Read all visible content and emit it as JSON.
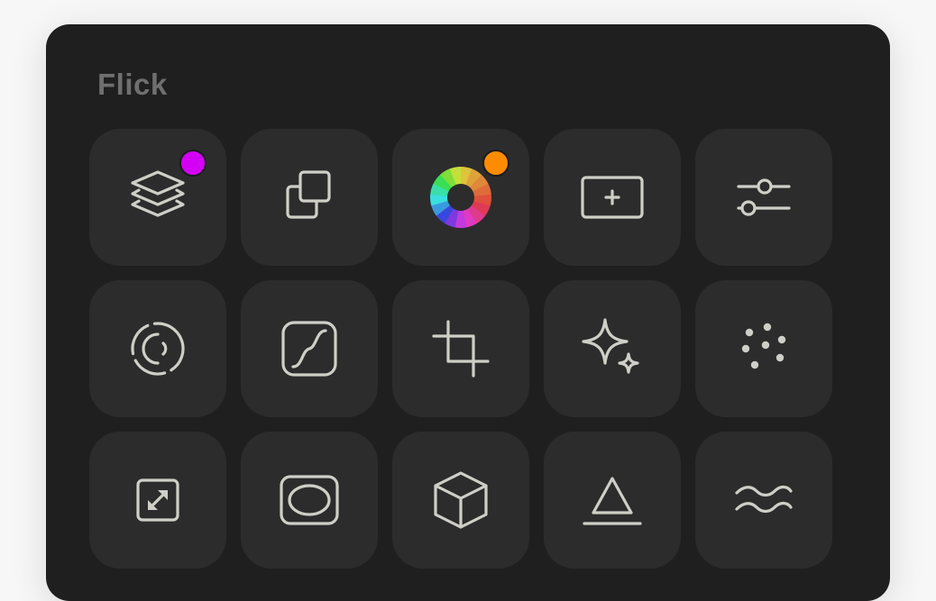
{
  "panel": {
    "title": "Flick"
  },
  "colors": {
    "layers_badge": "#d400f5",
    "color_wheel_badge": "#ff8c00",
    "icon_stroke": "#cfcfc8",
    "tile_bg": "#2c2c2c",
    "panel_bg": "#1f1f1f"
  },
  "tiles": [
    {
      "icon": "layers-icon",
      "badge": true
    },
    {
      "icon": "duplicate-icon",
      "badge": false
    },
    {
      "icon": "color-wheel-icon",
      "badge": true
    },
    {
      "icon": "add-frame-icon",
      "badge": false
    },
    {
      "icon": "sliders-icon",
      "badge": false
    },
    {
      "icon": "dashed-circle-icon",
      "badge": false
    },
    {
      "icon": "curves-icon",
      "badge": false
    },
    {
      "icon": "crop-icon",
      "badge": false
    },
    {
      "icon": "sparkle-icon",
      "badge": false
    },
    {
      "icon": "dots-icon",
      "badge": false
    },
    {
      "icon": "resize-icon",
      "badge": false
    },
    {
      "icon": "vignette-icon",
      "badge": false
    },
    {
      "icon": "cube-icon",
      "badge": false
    },
    {
      "icon": "triangle-icon",
      "badge": false
    },
    {
      "icon": "waves-icon",
      "badge": false
    }
  ]
}
